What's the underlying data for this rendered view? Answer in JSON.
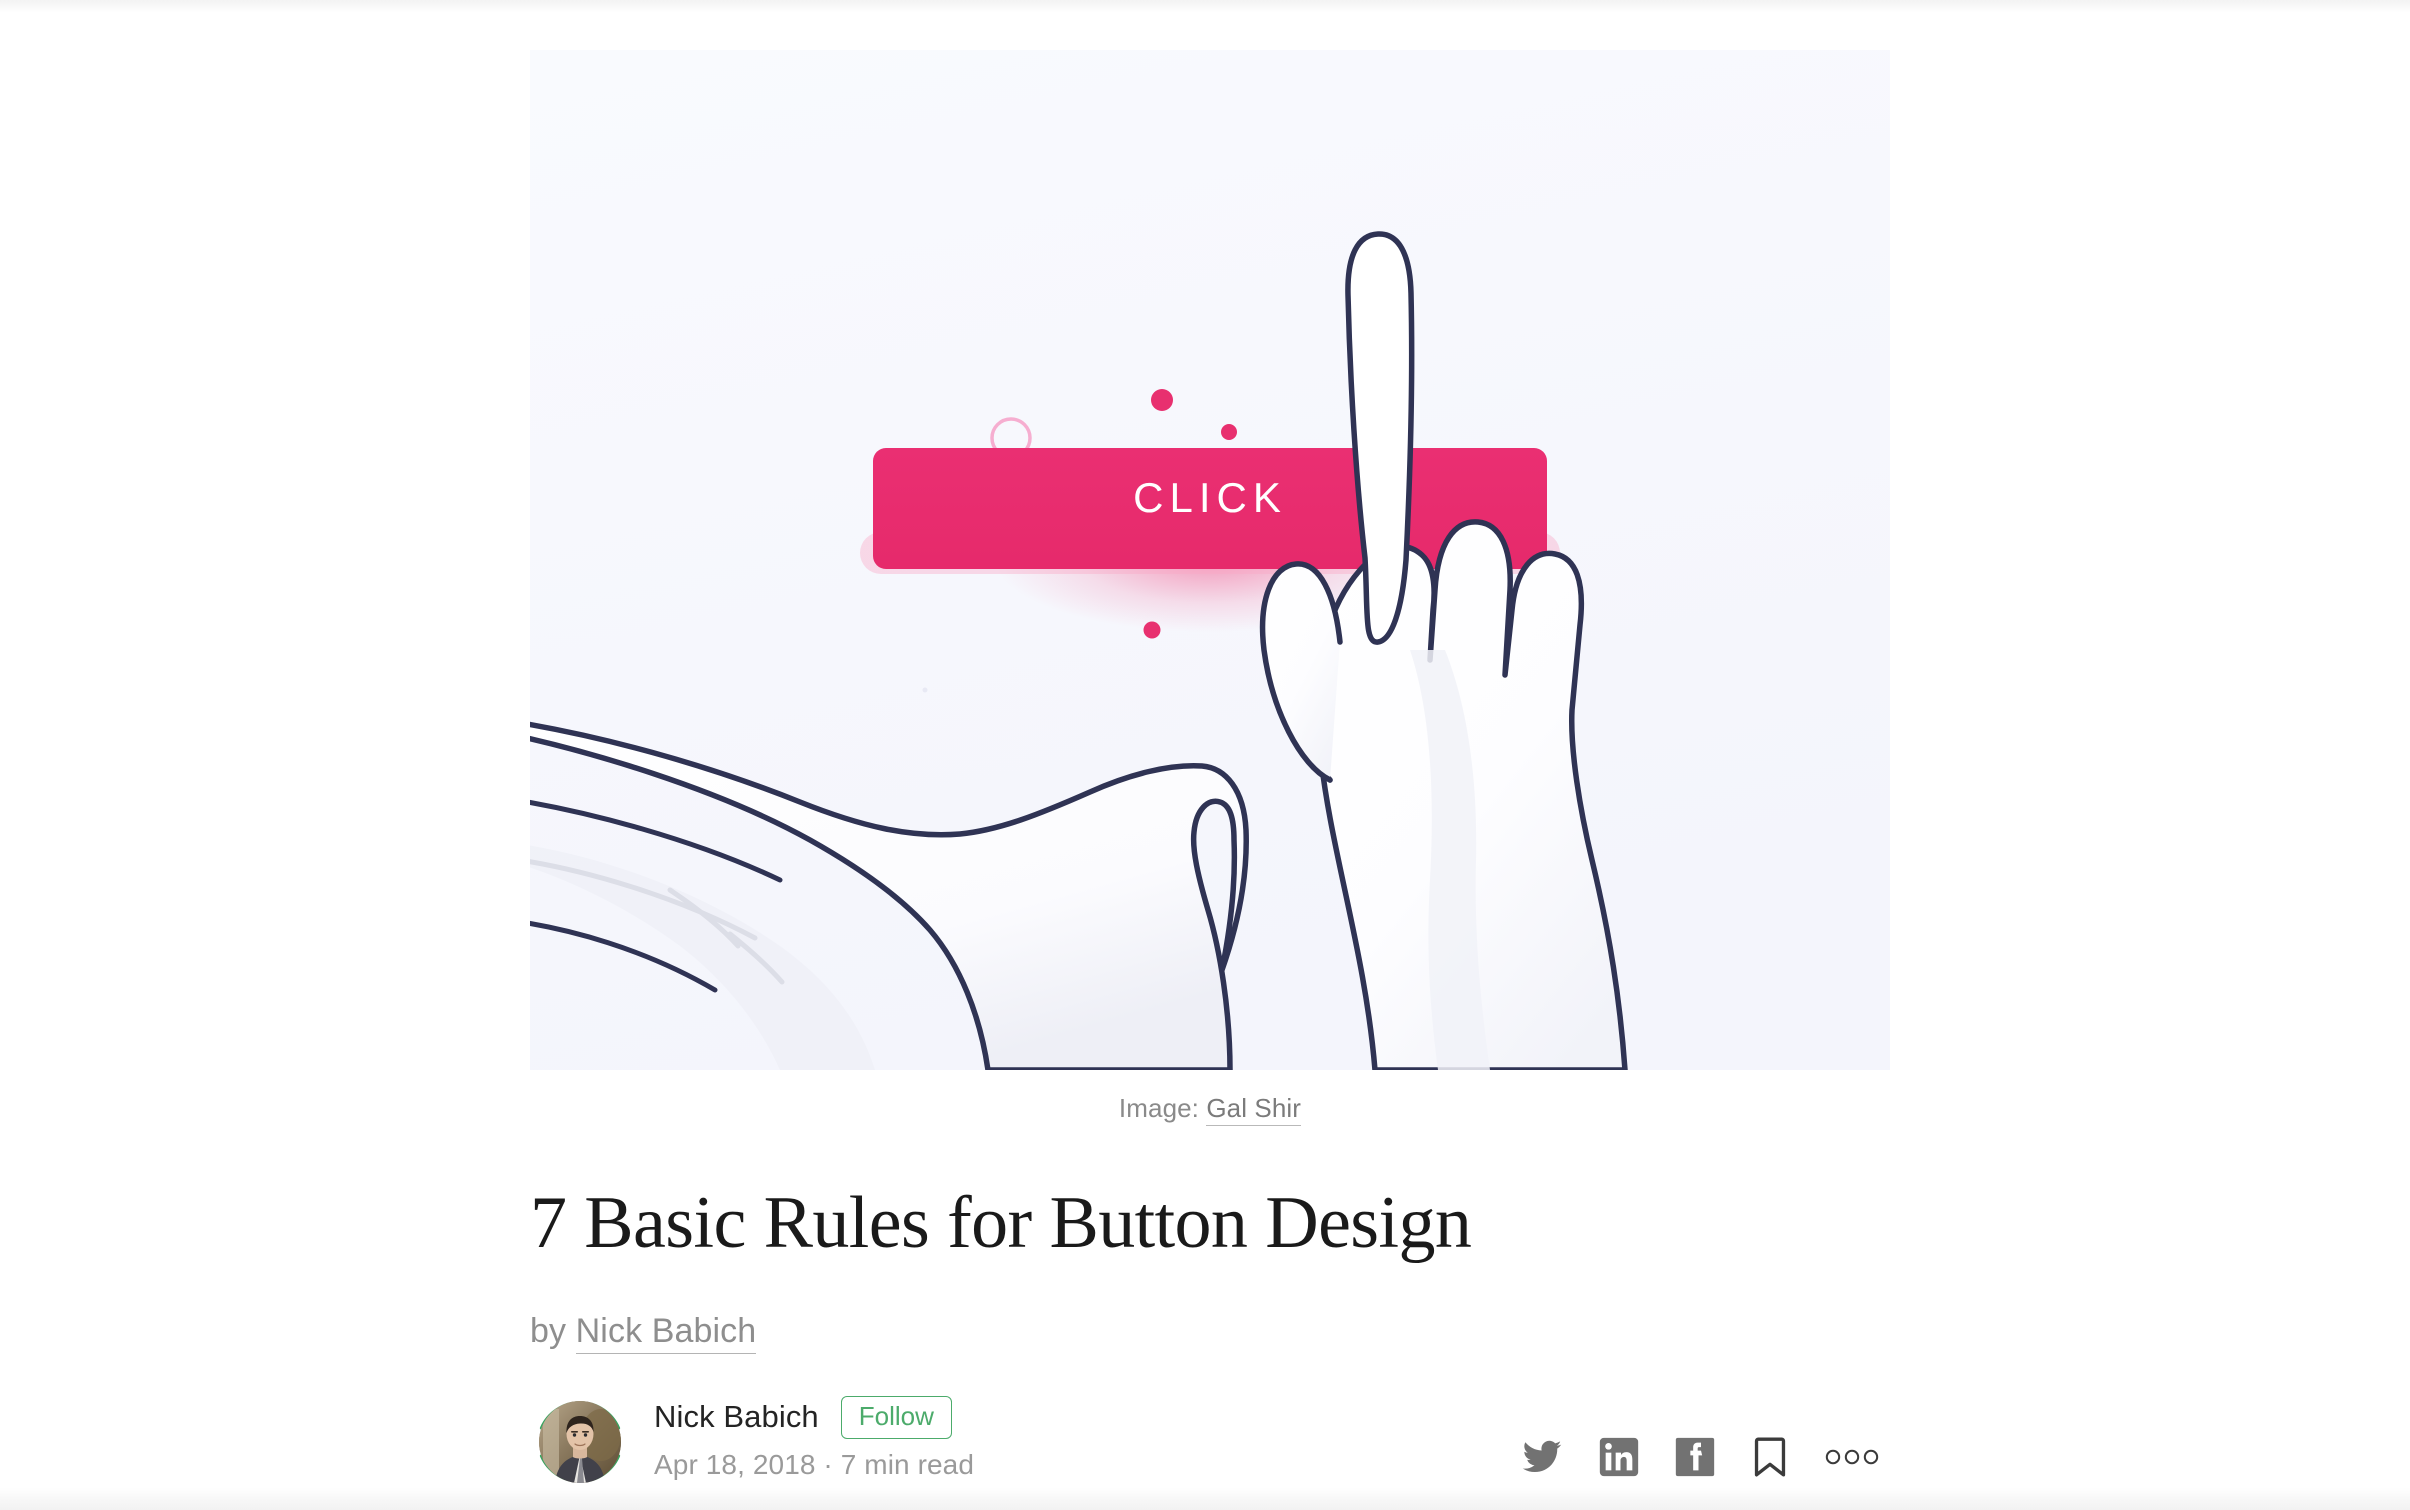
{
  "article": {
    "title": "7 Basic Rules for Button Design",
    "byline_prefix": "by ",
    "byline_author": "Nick Babich",
    "caption_prefix": "Image: ",
    "caption_link": "Gal Shir"
  },
  "hero": {
    "button_label": "CLICK",
    "bg_color": "#f7f8fd",
    "button_color": "#e8306f",
    "outline_color": "#2f3354",
    "accent_circle_color": "#f49ac4"
  },
  "meta": {
    "author_name": "Nick Babich",
    "follow_label": "Follow",
    "date": "Apr 18, 2018",
    "separator": " · ",
    "read_time": "7 min read",
    "follow_color": "#4cab6b"
  },
  "social": {
    "twitter": "twitter-icon",
    "linkedin": "linkedin-icon",
    "facebook": "facebook-icon",
    "bookmark": "bookmark-icon",
    "more": "more-options-icon"
  }
}
